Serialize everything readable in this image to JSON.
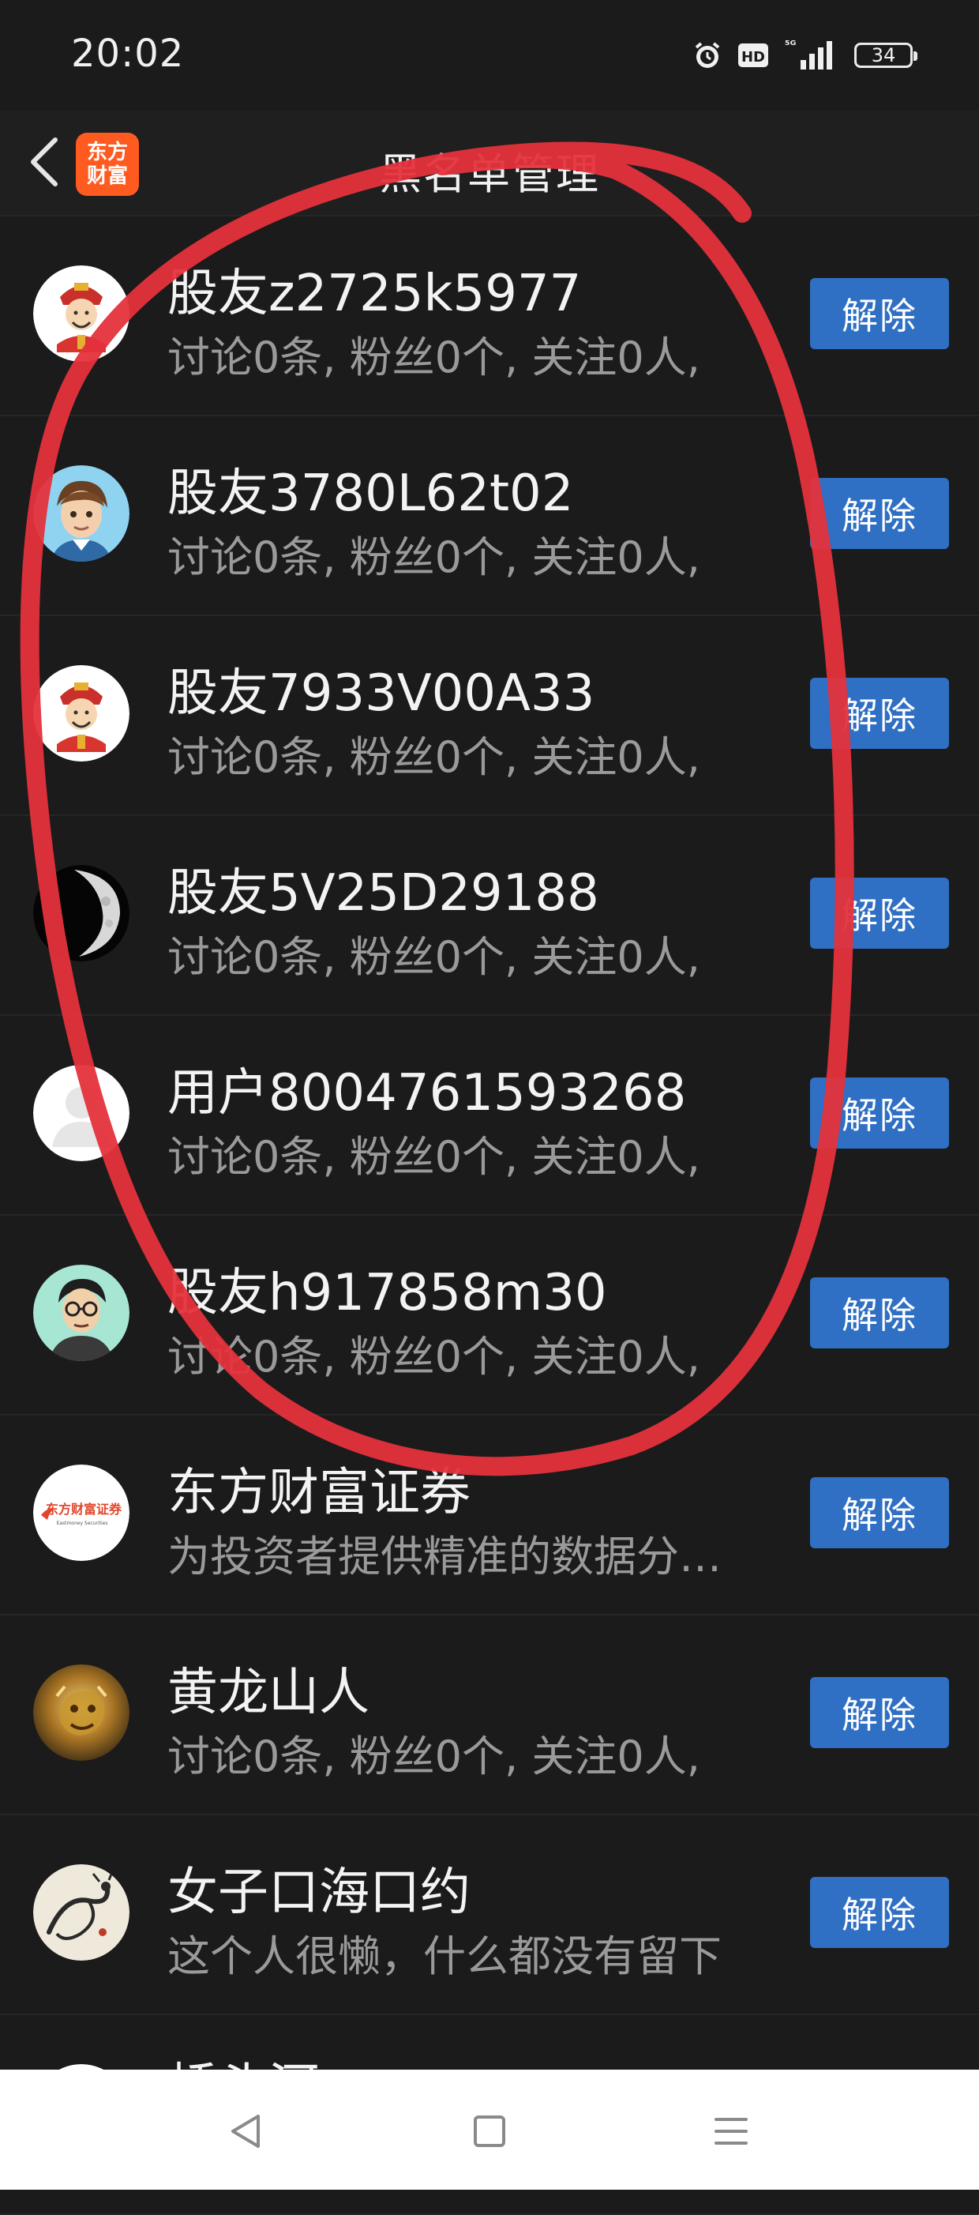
{
  "status_bar": {
    "time": "20:02",
    "network": "5G",
    "battery": "34",
    "icons": [
      "alarm-icon",
      "hd-icon",
      "signal-icon",
      "battery-icon"
    ]
  },
  "header": {
    "title": "黑名单管理",
    "logo_line1": "东方",
    "logo_line2": "财富"
  },
  "list": [
    {
      "name": "股友z2725k5977",
      "desc": "讨论0条, 粉丝0个, 关注0人,",
      "button": "解除",
      "avatar": "caishen-avatar"
    },
    {
      "name": "股友3780L62t02",
      "desc": "讨论0条, 粉丝0个, 关注0人,",
      "button": "解除",
      "avatar": "anime-boy-avatar"
    },
    {
      "name": "股友7933V00A33",
      "desc": "讨论0条, 粉丝0个, 关注0人,",
      "button": "解除",
      "avatar": "caishen-avatar"
    },
    {
      "name": "股友5V25D29188",
      "desc": "讨论0条, 粉丝0个, 关注0人,",
      "button": "解除",
      "avatar": "moon-avatar"
    },
    {
      "name": "用户8004761593268",
      "desc": "讨论0条, 粉丝0个, 关注0人,",
      "button": "解除",
      "avatar": "default-avatar"
    },
    {
      "name": "股友h917858m30",
      "desc": "讨论0条, 粉丝0个, 关注0人,",
      "button": "解除",
      "avatar": "cartoon-man-avatar"
    },
    {
      "name": "东方财富证券",
      "desc": "为投资者提供精准的数据分…",
      "button": "解除",
      "avatar": "eastmoney-securities-avatar",
      "avatar_text": "东方财富证券",
      "avatar_subtext": "Eastmoney Securities"
    },
    {
      "name": "黄龙山人",
      "desc": "讨论0条, 粉丝0个, 关注0人,",
      "button": "解除",
      "avatar": "golden-dragon-avatar"
    },
    {
      "name": "女子口海口约",
      "desc": "这个人很懒，什么都没有留下",
      "button": "解除",
      "avatar": "ink-dragon-avatar"
    }
  ],
  "partial_row": {
    "name": "桥头河"
  },
  "nav": {
    "icons": [
      "back-triangle-icon",
      "home-square-icon",
      "menu-lines-icon"
    ]
  },
  "colors": {
    "background": "#1b1b1b",
    "button": "#2f6fc4",
    "logo": "#ff5a1f",
    "annotation": "#e4323c"
  }
}
